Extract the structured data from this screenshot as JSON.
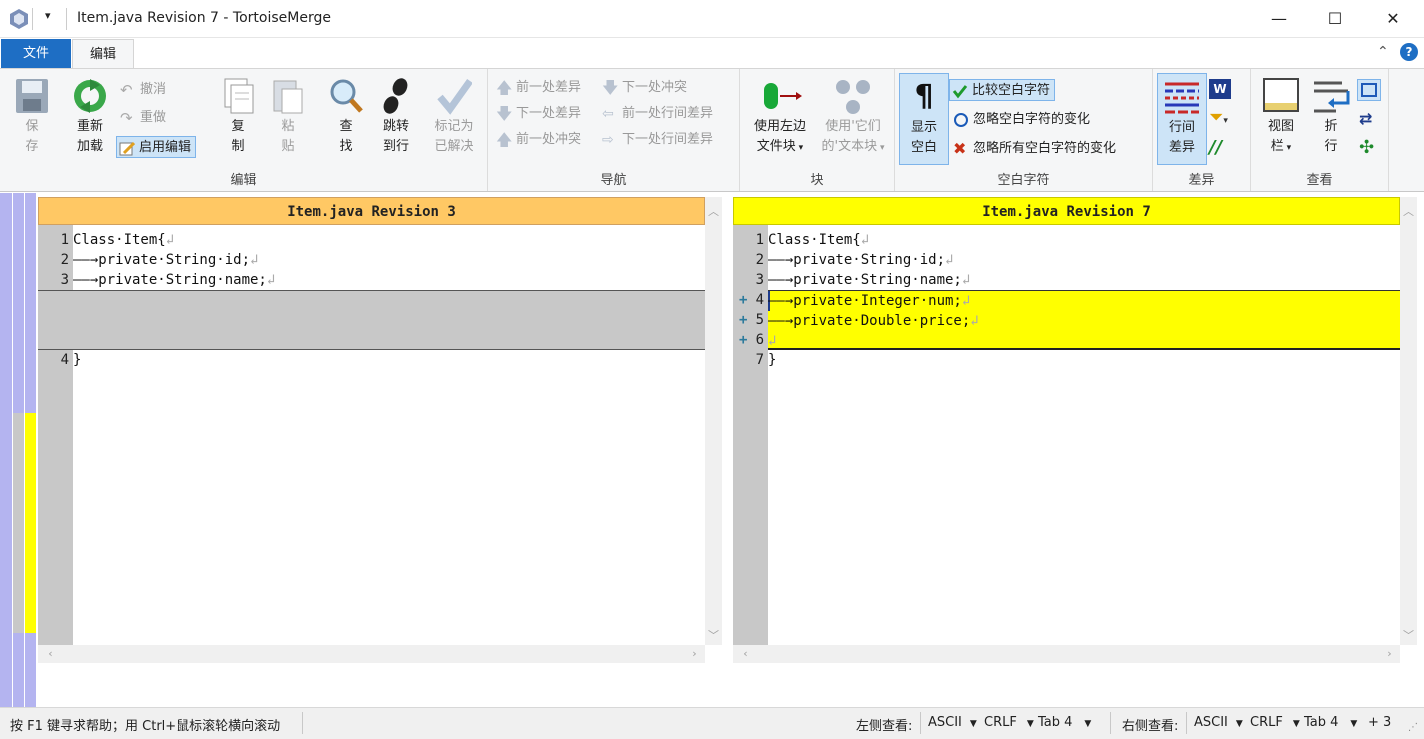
{
  "window": {
    "title": "Item.java Revision 7 - TortoiseMerge",
    "minimize": "—",
    "maximize": "☐",
    "close": "✕"
  },
  "tabs": {
    "file": "文件",
    "edit": "编辑"
  },
  "ribbon": {
    "edit_group": {
      "label": "编辑",
      "save": [
        "保",
        "存"
      ],
      "reload": [
        "重新",
        "加载"
      ],
      "undo": "撤消",
      "redo": "重做",
      "enable_edit": "启用编辑",
      "copy": [
        "复",
        "制"
      ],
      "paste": [
        "粘",
        "贴"
      ],
      "find": [
        "查",
        "找"
      ],
      "goto": [
        "跳转",
        "到行"
      ],
      "mark_resolved": [
        "标记为",
        "已解决"
      ]
    },
    "nav_group": {
      "label": "导航",
      "prev_diff": "前一处差异",
      "next_diff": "下一处差异",
      "prev_conflict": "前一处冲突",
      "next_conflict": "下一处冲突",
      "prev_inline": "前一处行间差异",
      "next_inline": "下一处行间差异"
    },
    "block_group": {
      "label": "块",
      "use_left": [
        "使用左边",
        "文件块"
      ],
      "use_their": [
        "使用'它们",
        "的'文本块"
      ]
    },
    "ws_group": {
      "label": "空白字符",
      "show_ws": [
        "显示",
        "空白"
      ],
      "compare_ws": "比较空白字符",
      "ignore_ws_change": "忽略空白字符的变化",
      "ignore_all_ws": "忽略所有空白字符的变化"
    },
    "diff_group": {
      "label": "差异",
      "inline_diff": [
        "行间",
        "差异"
      ]
    },
    "view_group": {
      "label": "查看",
      "view_bar": [
        "视图",
        "栏"
      ],
      "wrap": [
        "折",
        "行"
      ]
    }
  },
  "left_pane": {
    "header": "Item.java Revision 3",
    "lines": [
      {
        "num": "1",
        "text": "Class·Item{"
      },
      {
        "num": "2",
        "text": "——→private·String·id;"
      },
      {
        "num": "3",
        "text": "——→private·String·name;"
      },
      {
        "num": "4",
        "text": "}"
      }
    ]
  },
  "right_pane": {
    "header": "Item.java Revision 7",
    "lines": [
      {
        "num": "1",
        "text": "Class·Item{",
        "added": false
      },
      {
        "num": "2",
        "text": "——→private·String·id;",
        "added": false
      },
      {
        "num": "3",
        "text": "——→private·String·name;",
        "added": false
      },
      {
        "num": "4",
        "text": "——→private·Integer·num;",
        "added": true
      },
      {
        "num": "5",
        "text": "——→private·Double·price;",
        "added": true
      },
      {
        "num": "6",
        "text": "",
        "added": true
      },
      {
        "num": "7",
        "text": "}",
        "added": false
      }
    ]
  },
  "status": {
    "help": "按 F1 键寻求帮助；用 Ctrl+鼠标滚轮横向滚动",
    "left_view": "左侧查看:",
    "right_view": "右侧查看:",
    "encoding": "ASCII",
    "eol": "CRLF",
    "tab": "Tab 4",
    "count": "+ 3"
  },
  "colors": {
    "accent": "#1e6ec4",
    "left_header": "#ffc864",
    "right_header": "#ffff00",
    "added": "#ffff00",
    "empty": "#c8c8c8",
    "locator": "#b4b4f0"
  }
}
